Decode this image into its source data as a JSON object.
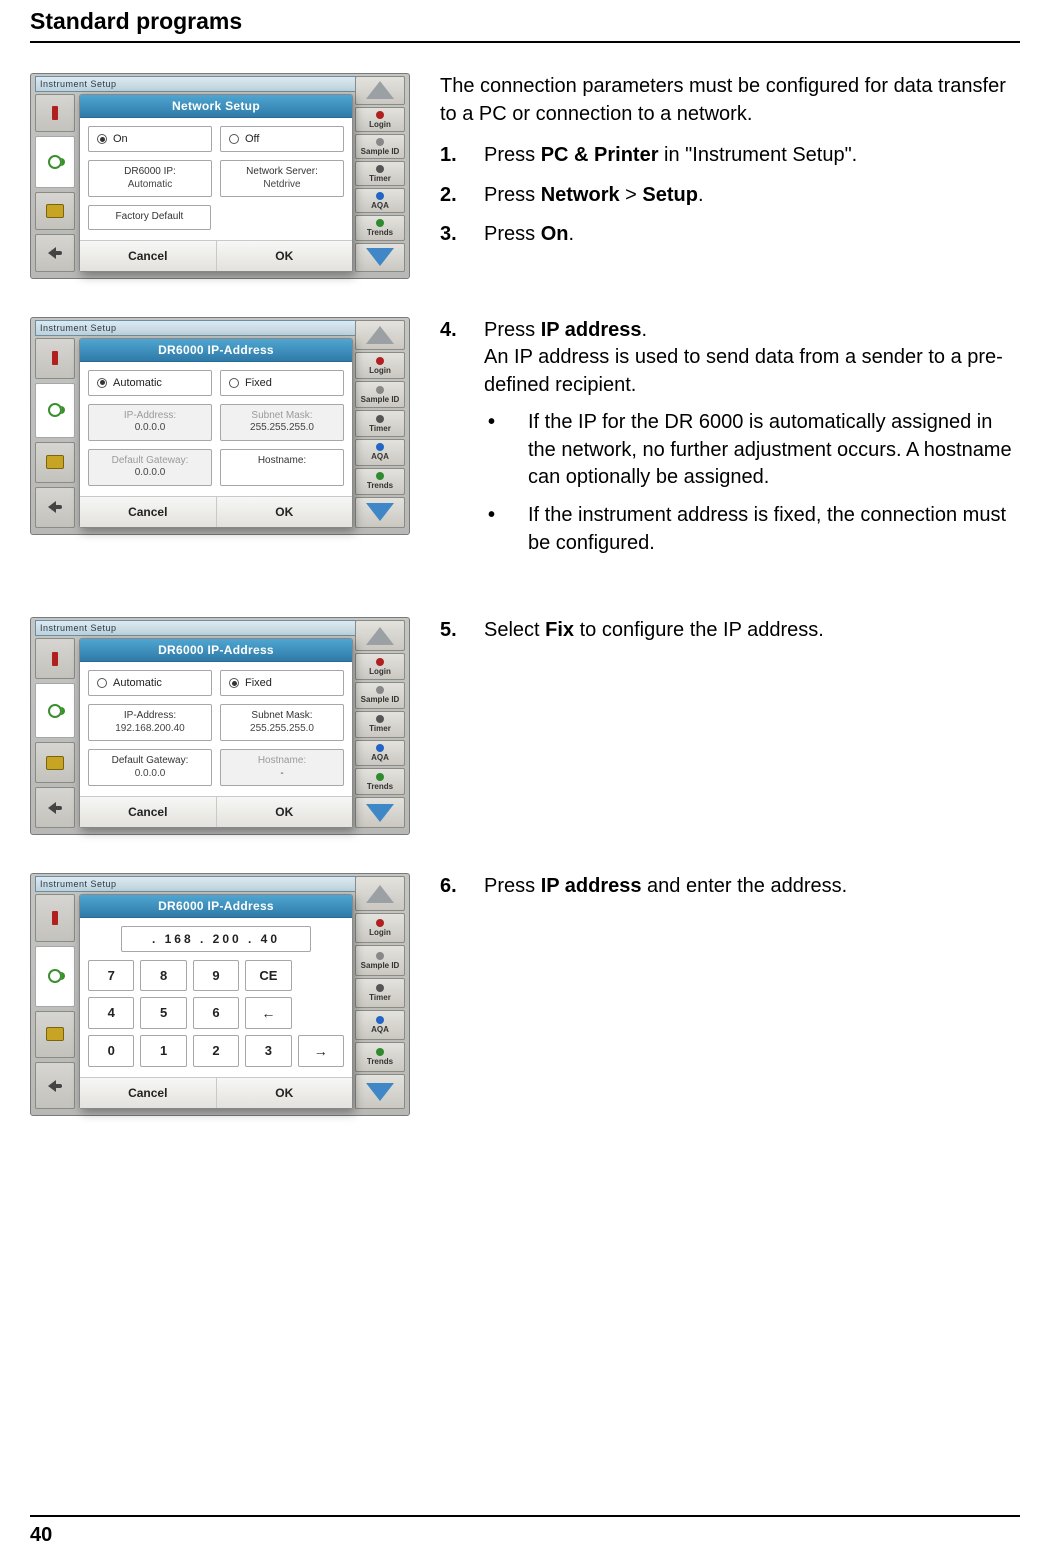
{
  "header": {
    "title": "Standard programs"
  },
  "footer": {
    "page": "40"
  },
  "sidebar_right": {
    "login": "Login",
    "sample": "Sample ID",
    "timer": "Timer",
    "aqa": "AQA",
    "trends": "Trends"
  },
  "shot1": {
    "tab": "Instrument Setup",
    "title": "Network Setup",
    "on": "On",
    "off": "Off",
    "ip": "DR6000 IP:",
    "ip_v": "Automatic",
    "srv": "Network Server:",
    "srv_v": "Netdrive",
    "factory": "Factory Default",
    "cancel": "Cancel",
    "ok": "OK"
  },
  "shot2": {
    "tab": "Instrument Setup",
    "title": "DR6000 IP-Address",
    "auto": "Automatic",
    "fixed": "Fixed",
    "ip_l": "IP-Address:",
    "ip_v": "0.0.0.0",
    "mask_l": "Subnet Mask:",
    "mask_v": "255.255.255.0",
    "gw_l": "Default Gateway:",
    "gw_v": "0.0.0.0",
    "host_l": "Hostname:",
    "host_v": "",
    "cancel": "Cancel",
    "ok": "OK"
  },
  "shot3": {
    "tab": "Instrument Setup",
    "title": "DR6000 IP-Address",
    "auto": "Automatic",
    "fixed": "Fixed",
    "ip_l": "IP-Address:",
    "ip_v": "192.168.200.40",
    "mask_l": "Subnet Mask:",
    "mask_v": "255.255.255.0",
    "gw_l": "Default Gateway:",
    "gw_v": "0.0.0.0",
    "host_l": "Hostname:",
    "host_v": "-",
    "cancel": "Cancel",
    "ok": "OK"
  },
  "shot4": {
    "tab": "Instrument Setup",
    "title": "DR6000 IP-Address",
    "entry": " . 168 . 200 . 40",
    "k7": "7",
    "k8": "8",
    "k9": "9",
    "kce": "CE",
    "k4": "4",
    "k5": "5",
    "k6": "6",
    "kleft": "←",
    "k0": "0",
    "k1": "1",
    "k2": "2",
    "k3": "3",
    "kright": "→",
    "cancel": "Cancel",
    "ok": "OK"
  },
  "text1": {
    "intro": "The connection parameters must be configured for data transfer to a PC or connection to a network.",
    "s1_n": "1.",
    "s1_a": "Press ",
    "s1_b": "PC & Printer",
    "s1_c": " in \"Instrument Setup\".",
    "s2_n": "2.",
    "s2_a": "Press ",
    "s2_b": "Network",
    "s2_c": " > ",
    "s2_d": "Setup",
    "s2_e": ".",
    "s3_n": "3.",
    "s3_a": "Press ",
    "s3_b": "On",
    "s3_c": "."
  },
  "text2": {
    "s4_n": "4.",
    "s4_a": "Press  ",
    "s4_b": "IP address",
    "s4_c": ".",
    "s4_line2": "An IP address is used to send data from a sender to a pre-defined recipient.",
    "b1": "If the IP for the DR 6000 is automatically assigned in the network, no further adjustment occurs. A hostname can optionally be assigned.",
    "b2": "If the instrument address is fixed, the connection must be configured."
  },
  "text3": {
    "s5_n": "5.",
    "s5_a": "Select ",
    "s5_b": "Fix",
    "s5_c": " to configure the IP address."
  },
  "text4": {
    "s6_n": "6.",
    "s6_a": "Press ",
    "s6_b": "IP address",
    "s6_c": " and enter the address."
  }
}
